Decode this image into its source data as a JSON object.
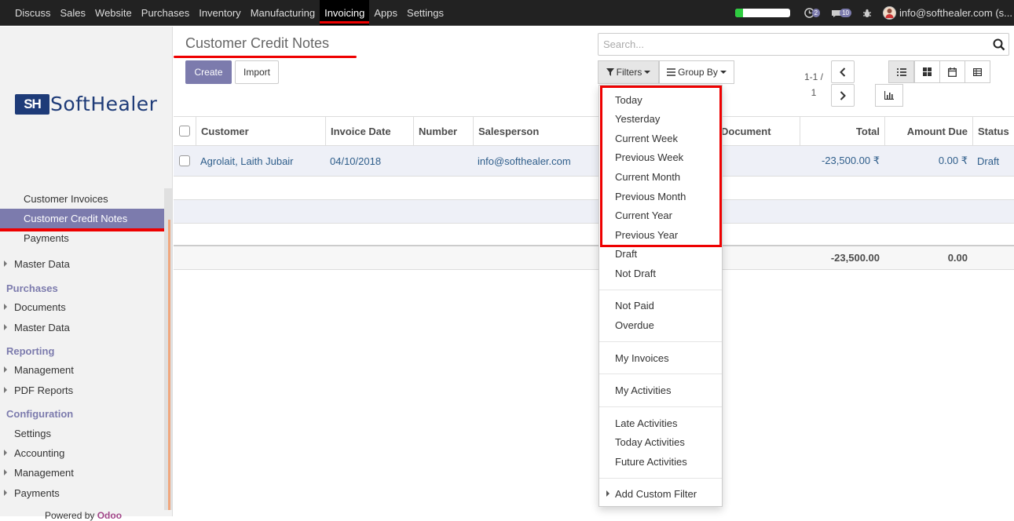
{
  "topbar": {
    "menu": [
      "Discuss",
      "Sales",
      "Website",
      "Purchases",
      "Inventory",
      "Manufacturing",
      "Invoicing",
      "Apps",
      "Settings"
    ],
    "active_menu": "Invoicing",
    "activity_badge": "2",
    "messages_badge": "10",
    "user": "info@softhealer.com (s..."
  },
  "sidebar": {
    "logo_mark": "SH",
    "logo_text": "SoftHealer",
    "sales_items": [
      "Customer Invoices",
      "Customer Credit Notes",
      "Payments"
    ],
    "sales_master": "Master Data",
    "purchases_head": "Purchases",
    "purchases_items": [
      "Documents",
      "Master Data"
    ],
    "reporting_head": "Reporting",
    "reporting_items": [
      "Management",
      "PDF Reports"
    ],
    "configuration_head": "Configuration",
    "configuration_settings": "Settings",
    "configuration_items": [
      "Accounting",
      "Management",
      "Payments"
    ],
    "powered_by": "Powered by",
    "powered_brand": "Odoo"
  },
  "control": {
    "title": "Customer Credit Notes",
    "create": "Create",
    "import": "Import",
    "search_placeholder": "Search...",
    "filters": "Filters",
    "group_by": "Group By",
    "pager_line1": "1-1 /",
    "pager_line2": "1"
  },
  "table": {
    "headers": {
      "customer": "Customer",
      "invoice_date": "Invoice Date",
      "number": "Number",
      "salesperson": "Salesperson",
      "source_document": "Document",
      "total": "Total",
      "amount_due": "Amount Due",
      "status": "Status"
    },
    "row": {
      "customer": "Agrolait, Laith Jubair",
      "invoice_date": "04/10/2018",
      "number": "",
      "salesperson": "info@softhealer.com",
      "total": "-23,500.00 ₹",
      "amount_due": "0.00 ₹",
      "status": "Draft"
    },
    "footer": {
      "total": "-23,500.00",
      "amount_due": "0.00"
    }
  },
  "filters_menu": {
    "dates": [
      "Today",
      "Yesterday",
      "Current Week",
      "Previous Week",
      "Current Month",
      "Previous Month",
      "Current Year",
      "Previous Year"
    ],
    "state": [
      "Draft",
      "Not Draft"
    ],
    "payment": [
      "Not Paid",
      "Overdue"
    ],
    "mine": [
      "My Invoices"
    ],
    "activities_mine": [
      "My Activities"
    ],
    "activities": [
      "Late Activities",
      "Today Activities",
      "Future Activities"
    ],
    "custom": "Add Custom Filter"
  }
}
